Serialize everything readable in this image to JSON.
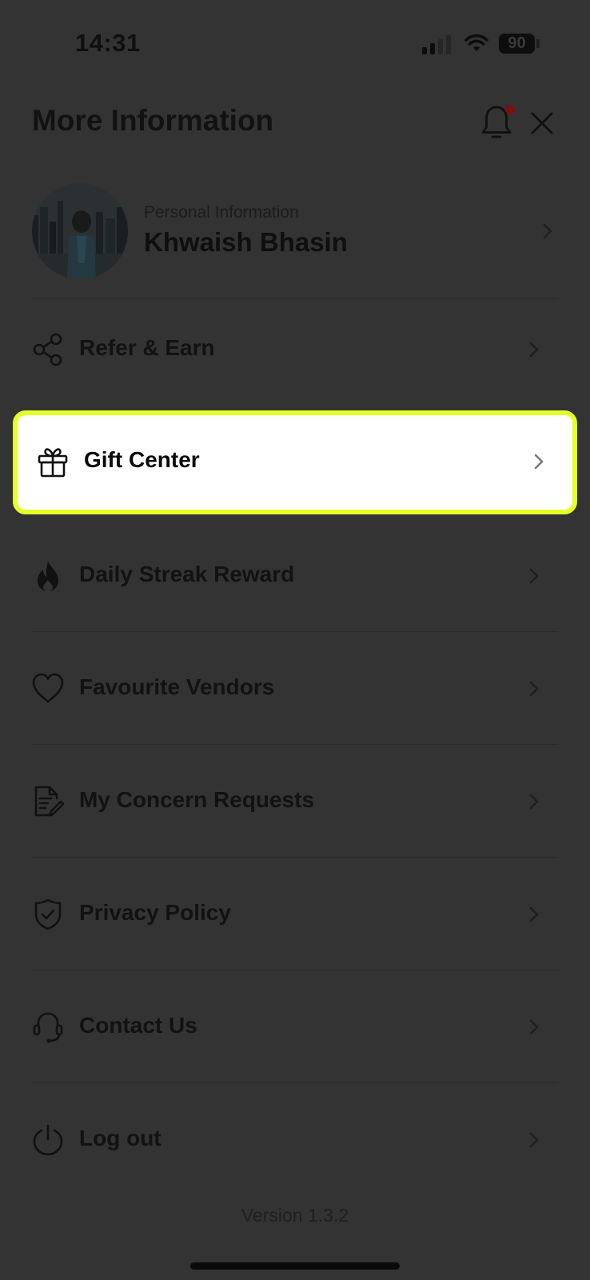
{
  "status_bar": {
    "time": "14:31",
    "battery_level": "90",
    "signal_icon": "cellular-signal-icon",
    "wifi_icon": "wifi-icon",
    "battery_icon": "battery-icon"
  },
  "header": {
    "title": "More Information",
    "notification_icon": "bell-icon",
    "notification_badge": true,
    "close_icon": "close-icon"
  },
  "profile": {
    "subtitle": "Personal Information",
    "name": "Khwaish Bhasin",
    "avatar": "avatar-photo",
    "chevron_icon": "chevron-right-icon"
  },
  "menu": [
    {
      "label": "Refer & Earn",
      "icon": "share-icon"
    },
    {
      "label": "Gift Center",
      "icon": "gift-icon",
      "highlighted": true
    },
    {
      "label": "Daily Streak Reward",
      "icon": "flame-icon"
    },
    {
      "label": "Favourite Vendors",
      "icon": "heart-icon"
    },
    {
      "label": "My Concern Requests",
      "icon": "document-edit-icon"
    },
    {
      "label": "Privacy Policy",
      "icon": "shield-check-icon"
    },
    {
      "label": "Contact Us",
      "icon": "headset-icon"
    },
    {
      "label": "Log out",
      "icon": "power-icon"
    }
  ],
  "footer": {
    "version": "Version 1.3.2"
  },
  "colors": {
    "overlay_background": "#333333",
    "highlight_border": "#e4ff2a",
    "highlight_background": "#ffffff",
    "notification_badge": "#7a1010"
  }
}
